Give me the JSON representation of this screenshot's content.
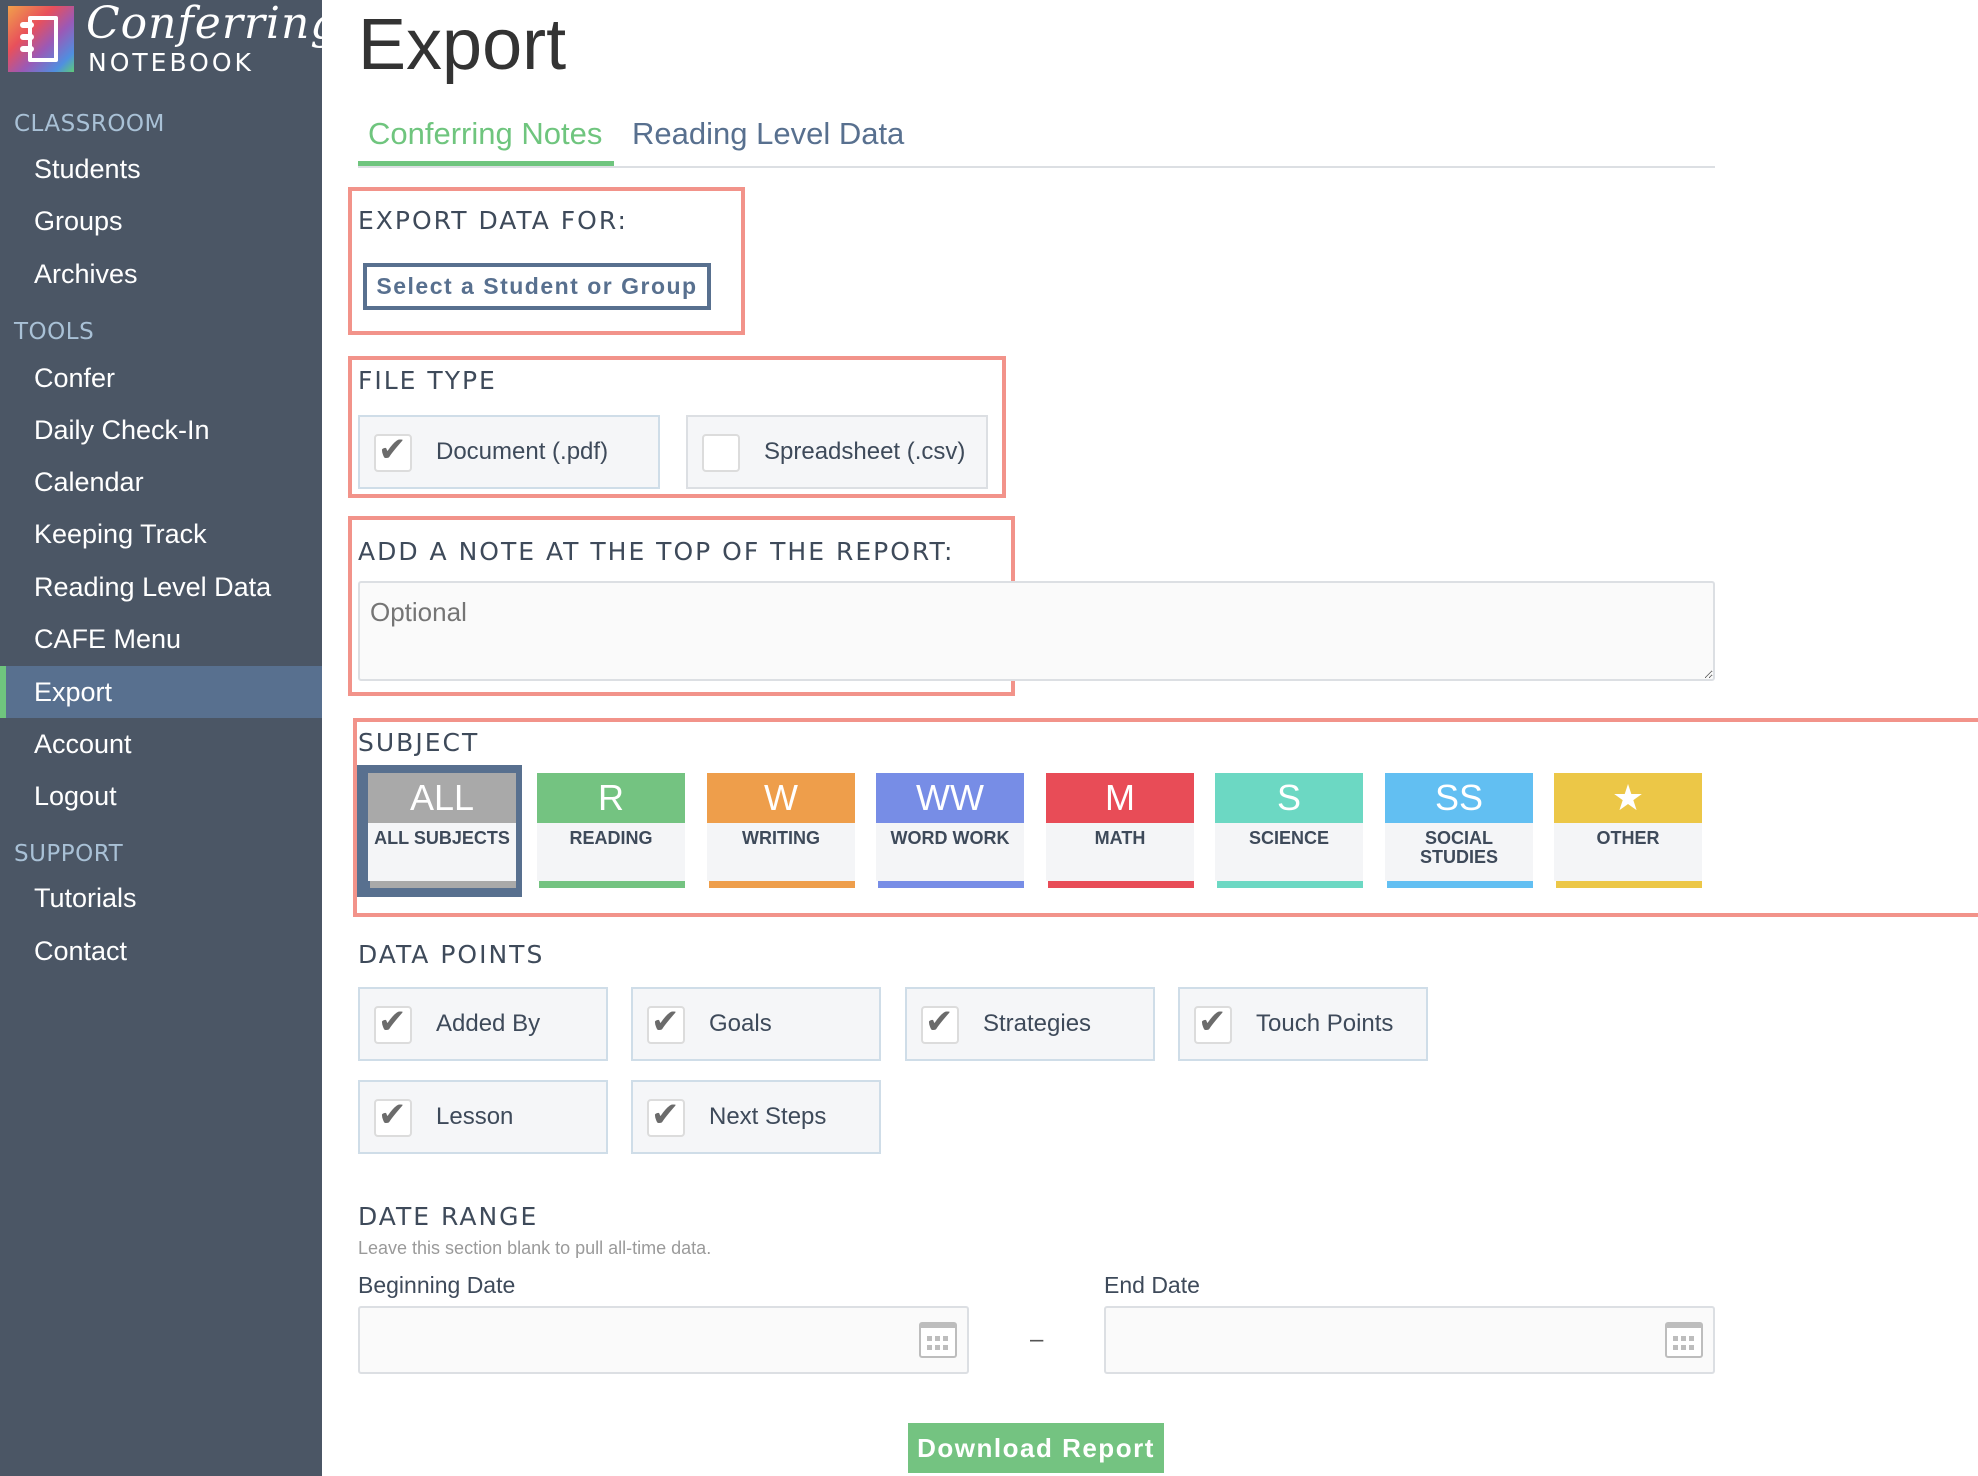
{
  "brand": {
    "script": "Conferring",
    "sub": "NOTEBOOK"
  },
  "sidebar": {
    "sections": [
      {
        "label": "CLASSROOM",
        "items": [
          "Students",
          "Groups",
          "Archives"
        ]
      },
      {
        "label": "TOOLS",
        "items": [
          "Confer",
          "Daily Check-In",
          "Calendar",
          "Keeping Track",
          "Reading Level Data",
          "CAFE Menu",
          "Export",
          "Account",
          "Logout"
        ]
      },
      {
        "label": "SUPPORT",
        "items": [
          "Tutorials",
          "Contact"
        ]
      }
    ],
    "active_item": "Export"
  },
  "page": {
    "title": "Export"
  },
  "tabs": [
    {
      "label": "Conferring Notes",
      "active": true
    },
    {
      "label": "Reading Level Data",
      "active": false
    }
  ],
  "export_for": {
    "label": "EXPORT DATA FOR:",
    "button": "Select a Student or Group"
  },
  "file_type": {
    "label": "FILE TYPE",
    "options": [
      {
        "label": "Document (.pdf)",
        "checked": true
      },
      {
        "label": "Spreadsheet (.csv)",
        "checked": false
      }
    ]
  },
  "note": {
    "label": "ADD A NOTE AT THE TOP OF THE REPORT:",
    "placeholder": "Optional",
    "value": ""
  },
  "subject": {
    "label": "SUBJECT",
    "selected": "ALL",
    "options": [
      {
        "abbr": "ALL",
        "name": "ALL SUBJECTS",
        "color": "#a9a9a9"
      },
      {
        "abbr": "R",
        "name": "READING",
        "color": "#74c381"
      },
      {
        "abbr": "W",
        "name": "WRITING",
        "color": "#ee9e4b"
      },
      {
        "abbr": "WW",
        "name": "WORD WORK",
        "color": "#778de6"
      },
      {
        "abbr": "M",
        "name": "MATH",
        "color": "#e84c57"
      },
      {
        "abbr": "S",
        "name": "SCIENCE",
        "color": "#6cd8c3"
      },
      {
        "abbr": "SS",
        "name": "SOCIAL STUDIES",
        "color": "#62bff2"
      },
      {
        "abbr": "★",
        "name": "OTHER",
        "color": "#ecc747"
      }
    ]
  },
  "data_points": {
    "label": "DATA POINTS",
    "options": [
      {
        "label": "Added By",
        "checked": true
      },
      {
        "label": "Goals",
        "checked": true
      },
      {
        "label": "Strategies",
        "checked": true
      },
      {
        "label": "Touch Points",
        "checked": true
      },
      {
        "label": "Lesson",
        "checked": true
      },
      {
        "label": "Next Steps",
        "checked": true
      }
    ]
  },
  "date_range": {
    "label": "DATE RANGE",
    "hint": "Leave this section blank to pull all-time data.",
    "begin_label": "Beginning Date",
    "end_label": "End Date",
    "separator": "–",
    "begin_value": "",
    "end_value": ""
  },
  "download_button": "Download Report",
  "colors": {
    "sidebar": "#4b5665",
    "active_nav": "#58708f",
    "accent_green": "#6fc57e",
    "highlight_box": "#f2938a"
  }
}
